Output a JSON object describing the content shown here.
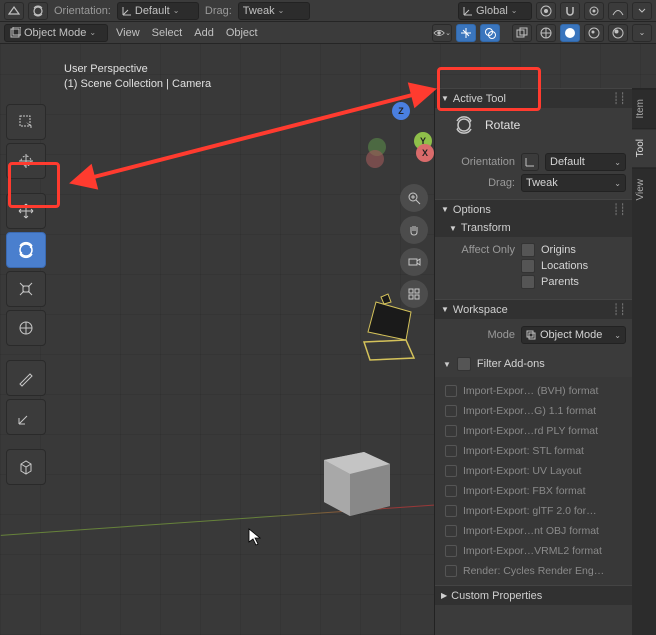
{
  "header": {
    "orientation_label": "Orientation:",
    "orientation_value": "Default",
    "drag_label": "Drag:",
    "drag_value": "Tweak",
    "transform_space": "Global",
    "mode": "Object Mode",
    "menus": [
      "View",
      "Select",
      "Add",
      "Object"
    ]
  },
  "viewport": {
    "line1": "User Perspective",
    "line2": "(1) Scene Collection | Camera"
  },
  "toolbar": {
    "tools": [
      {
        "name": "select-box-tool"
      },
      {
        "name": "cursor-tool"
      },
      {
        "name": "move-tool"
      },
      {
        "name": "rotate-tool",
        "active": true
      },
      {
        "name": "scale-tool"
      },
      {
        "name": "transform-tool"
      },
      {
        "name": "annotate-tool"
      },
      {
        "name": "measure-tool"
      },
      {
        "name": "add-cube-tool"
      }
    ]
  },
  "nav_gizmo": {
    "z": "Z",
    "x": "X",
    "y": "Y"
  },
  "side_tabs": [
    "Item",
    "Tool",
    "View"
  ],
  "panel": {
    "active_tool_header": "Active Tool",
    "tool_name": "Rotate",
    "orientation_label": "Orientation",
    "orientation_value": "Default",
    "drag_label": "Drag:",
    "drag_value": "Tweak",
    "options_header": "Options",
    "transform_header": "Transform",
    "affect_only_label": "Affect Only",
    "affect": [
      "Origins",
      "Locations",
      "Parents"
    ],
    "workspace_header": "Workspace",
    "mode_label": "Mode",
    "mode_value": "Object Mode",
    "filter_label": "Filter Add-ons",
    "addons": [
      "Import-Expor… (BVH) format",
      "Import-Expor…G) 1.1 format",
      "Import-Expor…rd PLY format",
      "Import-Export: STL format",
      "Import-Export: UV Layout",
      "Import-Export: FBX format",
      "Import-Export: glTF 2.0 for…",
      "Import-Expor…nt OBJ format",
      "Import-Expor…VRML2 format",
      "Render: Cycles Render Eng…"
    ],
    "custom_props_header": "Custom Properties"
  }
}
